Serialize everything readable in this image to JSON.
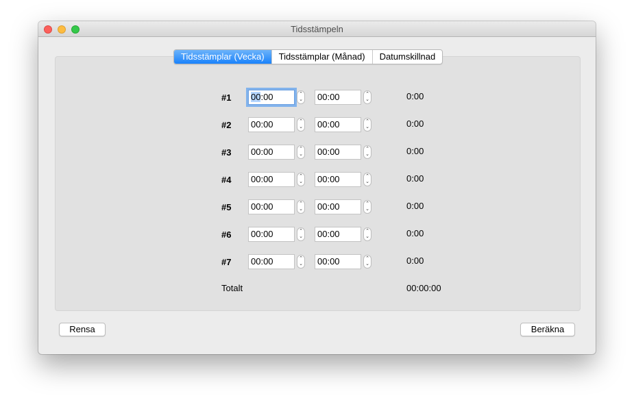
{
  "window": {
    "title": "Tidsstämpeln"
  },
  "tabs": [
    {
      "label": "Tidsstämplar (Vecka)",
      "active": true
    },
    {
      "label": "Tidsstämplar (Månad)",
      "active": false
    },
    {
      "label": "Datumskillnad",
      "active": false
    }
  ],
  "rows": [
    {
      "label": "#1",
      "start": "00:00",
      "end": "00:00",
      "result": "0:00"
    },
    {
      "label": "#2",
      "start": "00:00",
      "end": "00:00",
      "result": "0:00"
    },
    {
      "label": "#3",
      "start": "00:00",
      "end": "00:00",
      "result": "0:00"
    },
    {
      "label": "#4",
      "start": "00:00",
      "end": "00:00",
      "result": "0:00"
    },
    {
      "label": "#5",
      "start": "00:00",
      "end": "00:00",
      "result": "0:00"
    },
    {
      "label": "#6",
      "start": "00:00",
      "end": "00:00",
      "result": "0:00"
    },
    {
      "label": "#7",
      "start": "00:00",
      "end": "00:00",
      "result": "0:00"
    }
  ],
  "total": {
    "label": "Totalt",
    "value": "00:00:00"
  },
  "buttons": {
    "clear": "Rensa",
    "calculate": "Beräkna"
  },
  "icons": {
    "stepper_up": "chevron-up-icon",
    "stepper_down": "chevron-down-icon"
  }
}
